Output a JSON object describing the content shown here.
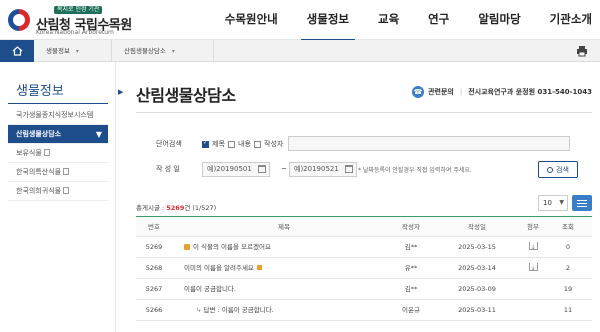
{
  "header": {
    "logo_tag": "복지로 인정 기관",
    "logo_name": "산림청 국립수목원",
    "logo_eng": "Korea National Arboretum",
    "nav": [
      {
        "label": "수목원안내"
      },
      {
        "label": "생물정보",
        "active": true
      },
      {
        "label": "교육"
      },
      {
        "label": "연구"
      },
      {
        "label": "알림마당"
      },
      {
        "label": "기관소개"
      }
    ]
  },
  "breadcrumb": [
    "생물정보",
    "산림생물상담소"
  ],
  "sidebar": {
    "title": "생물정보",
    "items": [
      {
        "label": "국가생물종지식정보시스템"
      },
      {
        "label": "산림생물상담소",
        "active": true
      },
      {
        "label": "보유식물"
      },
      {
        "label": "한국의특산식물"
      },
      {
        "label": "한국의희귀식물"
      }
    ]
  },
  "page": {
    "title": "산림생물상담소",
    "contact_label": "관련문의",
    "contact_value": "전시교육연구과 윤정원 031-540-1043"
  },
  "search": {
    "keyword_label": "단어검색",
    "options": [
      {
        "label": "제목",
        "checked": true
      },
      {
        "label": "내용",
        "checked": false
      },
      {
        "label": "작성자",
        "checked": false
      }
    ],
    "keyword_value": "",
    "date_label": "작 성 일",
    "date_from": "예)20190501",
    "date_to": "예)20190521",
    "tilde": "~",
    "hint": "* 날짜등록이 안될경우 직접 입력하여 주세요.",
    "button_label": "검색"
  },
  "list": {
    "count_prefix": "총게시글 : ",
    "count_num": "5269",
    "count_suffix": "건 (1/527)",
    "per_page": "10",
    "columns": [
      "번호",
      "제목",
      "작성자",
      "작성일",
      "첨부",
      "조회"
    ],
    "rows": [
      {
        "no": "5269",
        "title": "이 식물의 이름을 모르겠어요",
        "writer": "김**",
        "date": "2025-03-15",
        "file": true,
        "views": "0",
        "lock": true
      },
      {
        "no": "5268",
        "title": "이미의 이름을 알려주세요",
        "writer": "유**",
        "date": "2025-03-14",
        "file": true,
        "views": "2",
        "new": true
      },
      {
        "no": "5267",
        "title": "이름이 궁금합니다.",
        "writer": "김**",
        "date": "2025-03-09",
        "file": false,
        "views": "19"
      },
      {
        "no": "5266",
        "title": "답변 : 이름이 궁금합니다.",
        "writer": "이윤규",
        "date": "2025-03-11",
        "file": false,
        "views": "11",
        "reply": true
      }
    ]
  },
  "icons": {
    "home": "home-icon",
    "print": "print-icon",
    "accent": "#1e4d8c"
  }
}
